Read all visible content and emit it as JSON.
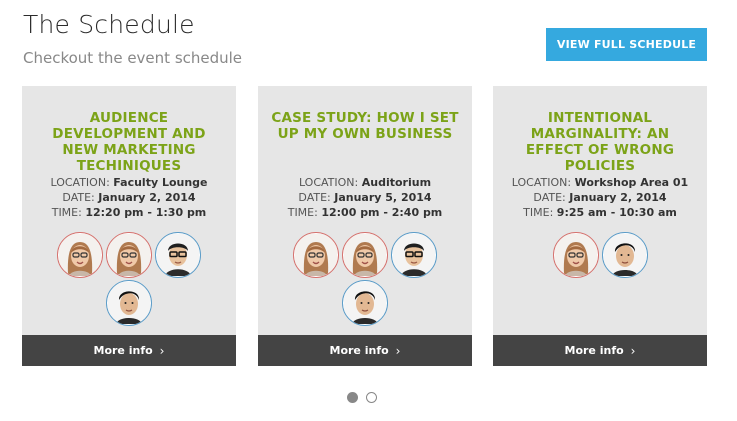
{
  "header": {
    "title": "The Schedule",
    "subtitle": "Checkout the event schedule",
    "cta_label": "VIEW FULL SCHEDULE"
  },
  "labels": {
    "location": "LOCATION:",
    "date": "DATE:",
    "time": "TIME:",
    "more": "More info",
    "chevron": "›"
  },
  "events": [
    {
      "title": "AUDIENCE DEVELOPMENT AND NEW MARKETING TECHINIQUES",
      "location": "Faculty Lounge",
      "date": "January 2, 2014",
      "time": "12:20 pm - 1:30 pm",
      "speakers": [
        "female-speaker",
        "female-speaker",
        "male-speaker-glasses",
        "male-speaker"
      ]
    },
    {
      "title": "CASE STUDY: HOW I SET UP MY OWN BUSINESS",
      "location": "Auditorium",
      "date": "January 5, 2014",
      "time": "12:00 pm - 2:40 pm",
      "speakers": [
        "female-speaker",
        "female-speaker",
        "male-speaker-glasses",
        "male-speaker"
      ]
    },
    {
      "title": "INTENTIONAL MARGINALITY: AN EFFECT OF WRONG POLICIES",
      "location": "Workshop Area 01",
      "date": "January 2, 2014",
      "time": "9:25 am - 10:30 am",
      "speakers": [
        "female-speaker",
        "male-speaker"
      ]
    }
  ],
  "pagination": {
    "pages": 2,
    "current": 1
  },
  "colors": {
    "accent": "#35a9df",
    "title_green": "#7ca318",
    "card_bg": "#e6e6e6",
    "footer_bg": "#444444"
  }
}
